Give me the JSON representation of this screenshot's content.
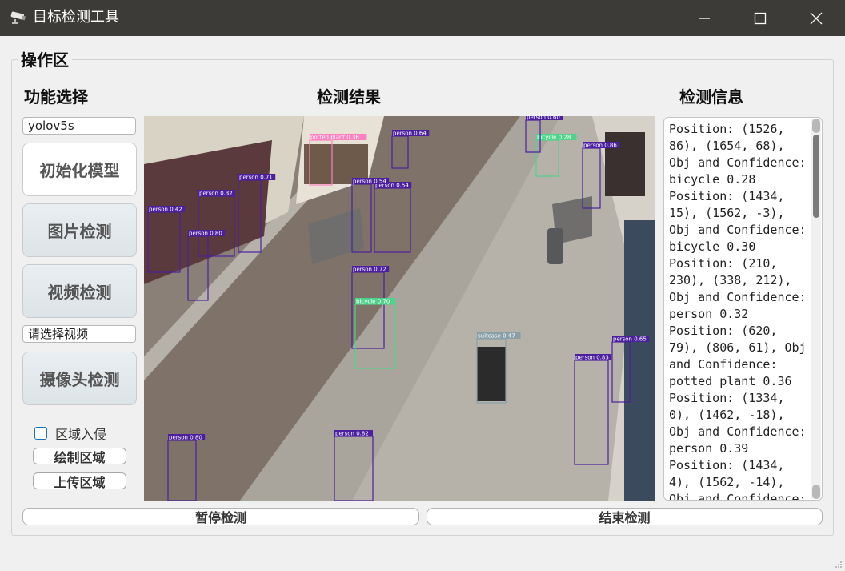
{
  "window": {
    "title": "目标检测工具",
    "icon": "security-camera-icon"
  },
  "group": {
    "title": "操作区"
  },
  "sections": {
    "function_title": "功能选择",
    "result_title": "检测结果",
    "info_title": "检测信息"
  },
  "controls": {
    "model_select": "yolov5s",
    "init_model": "初始化模型",
    "image_detect": "图片检测",
    "video_detect": "视频检测",
    "video_select": "请选择视频",
    "camera_detect": "摄像头检测",
    "region_intrusion": "区域入侵",
    "draw_region": "绘制区域",
    "upload_region": "上传区域",
    "pause_detect": "暂停检测",
    "stop_detect": "结束检测"
  },
  "detection_info": "Position: (1526, 86), (1654, 68), Obj and Confidence: bicycle 0.28\nPosition: (1434, 15), (1562, -3), Obj and Confidence: bicycle 0.30\nPosition: (210, 230), (338, 212), Obj and Confidence: person 0.32\nPosition: (620, 79), (806, 61), Obj and Confidence: potted plant 0.36\nPosition: (1334, 0), (1462, -18), Obj and Confidence: person 0.39\nPosition: (1434, 4), (1562, -14), Obj and Confidence:",
  "detections": [
    {
      "label": "potted plant 0.36",
      "color": "#ff7fbf"
    },
    {
      "label": "person 0.64",
      "color": "#4b1f9e"
    },
    {
      "label": "person 0.54",
      "color": "#4b1f9e"
    },
    {
      "label": "person 0.71",
      "color": "#4b1f9e"
    },
    {
      "label": "person 0.32",
      "color": "#4b1f9e"
    },
    {
      "label": "person 0.42",
      "color": "#4b1f9e"
    },
    {
      "label": "person 0.80",
      "color": "#4b1f9e"
    },
    {
      "label": "person 0.72",
      "color": "#4b1f9e"
    },
    {
      "label": "bicycle 0.70",
      "color": "#4fd38a"
    },
    {
      "label": "bicycle 0.28",
      "color": "#4fd38a"
    },
    {
      "label": "person 0.86",
      "color": "#4b1f9e"
    },
    {
      "label": "suitcase 0.47",
      "color": "#8aa0a8"
    },
    {
      "label": "person 0.83",
      "color": "#4b1f9e"
    },
    {
      "label": "person 0.65",
      "color": "#4b1f9e"
    },
    {
      "label": "person 0.80",
      "color": "#4b1f9e"
    },
    {
      "label": "person 0.82",
      "color": "#4b1f9e"
    },
    {
      "label": "person 0.54",
      "color": "#4b1f9e"
    },
    {
      "label": "person 0.60",
      "color": "#4b1f9e"
    }
  ]
}
